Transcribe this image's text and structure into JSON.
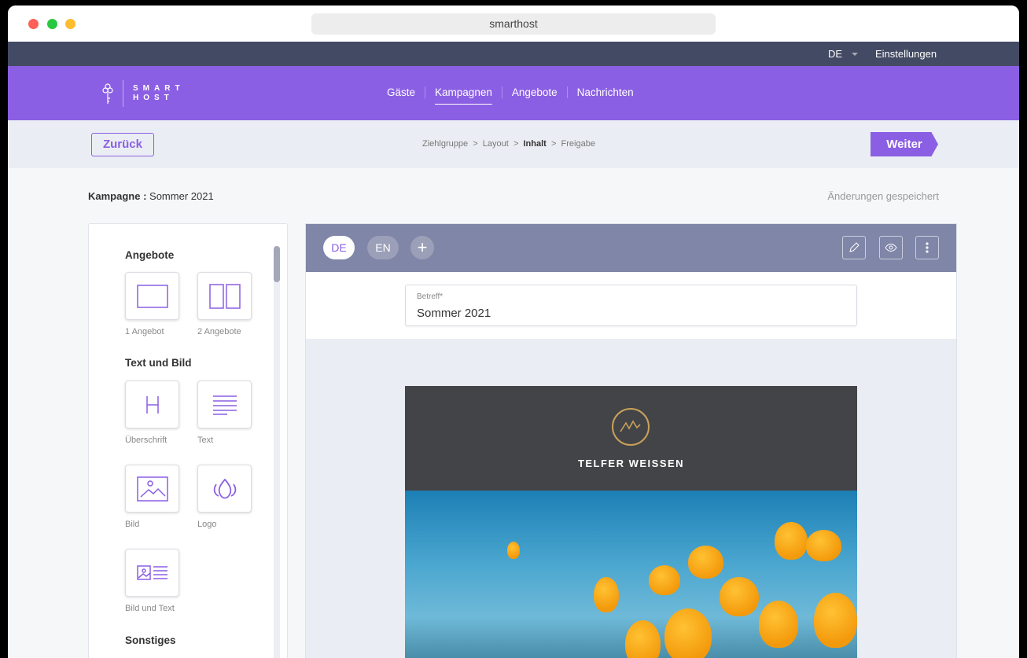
{
  "browser": {
    "url": "smarthost"
  },
  "topbar": {
    "language": "DE",
    "settings": "Einstellungen"
  },
  "brand": {
    "line1": "SMART",
    "line2": "HOST"
  },
  "nav": [
    {
      "label": "Gäste"
    },
    {
      "label": "Kampagnen",
      "active": true
    },
    {
      "label": "Angebote"
    },
    {
      "label": "Nachrichten"
    }
  ],
  "steps": {
    "back": "Zurück",
    "next": "Weiter",
    "crumbs": [
      "Ziehlgruppe",
      "Layout",
      "Inhalt",
      "Freigabe"
    ],
    "separator": ">",
    "current": "Inhalt"
  },
  "campaign": {
    "label": "Kampagne :",
    "name": "Sommer 2021",
    "status": "Änderungen gespeichert"
  },
  "sidebar": {
    "sections": [
      {
        "title": "Angebote",
        "items": [
          {
            "label": "1 Angebot",
            "icon": "single-box-icon"
          },
          {
            "label": "2 Angebote",
            "icon": "double-box-icon"
          }
        ]
      },
      {
        "title": "Text und Bild",
        "items": [
          {
            "label": "Überschrift",
            "icon": "heading-icon"
          },
          {
            "label": "Text",
            "icon": "text-lines-icon"
          },
          {
            "label": "Bild",
            "icon": "image-icon"
          },
          {
            "label": "Logo",
            "icon": "lotus-icon"
          },
          {
            "label": "Bild und Text",
            "icon": "image-text-icon"
          }
        ]
      },
      {
        "title": "Sonstiges"
      }
    ]
  },
  "editor": {
    "languages": [
      {
        "label": "DE",
        "active": true
      },
      {
        "label": "EN"
      }
    ],
    "add": "+",
    "subject": {
      "label": "Betreff*",
      "value": "Sommer 2021"
    },
    "mail": {
      "brand": "TELFER WEISSEN"
    }
  },
  "colors": {
    "accent": "#8b5fe3",
    "topbar": "#434a63",
    "toolbar": "#7f86a8",
    "mailHeader": "#434447",
    "gold": "#c9a15a"
  }
}
